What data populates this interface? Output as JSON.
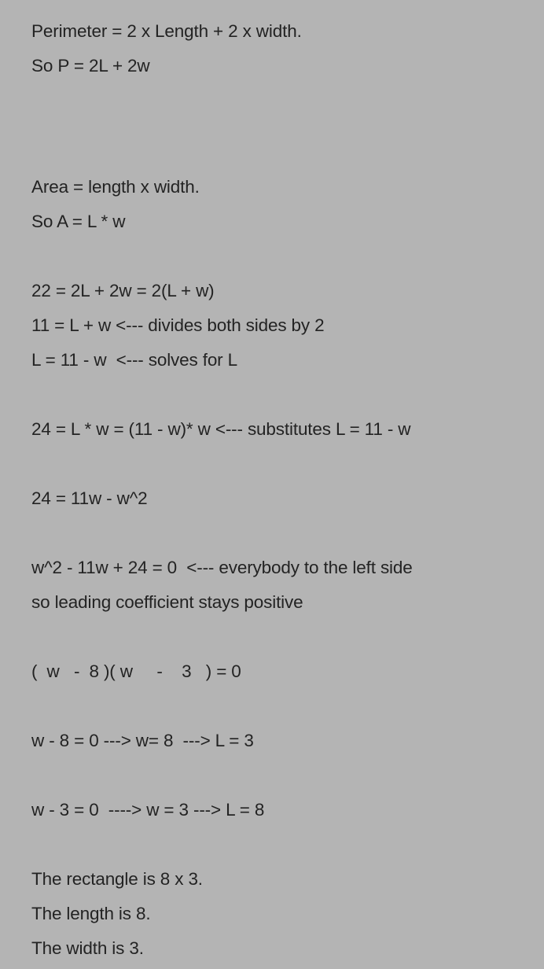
{
  "document": {
    "background_color": "#b4b4b4",
    "text_color": "#232323",
    "title": "Rectangle perimeter and area word problem solution",
    "blocks": [
      {
        "id": "formulas-perimeter",
        "lines": [
          "Perimeter = 2 x Length + 2 x width.",
          "So P = 2L + 2w"
        ]
      },
      {
        "id": "formulas-area",
        "lines": [
          "Area = length x width.",
          "So A = L * w"
        ]
      },
      {
        "id": "solve-for-L",
        "lines": [
          "22 = 2L + 2w = 2(L + w)",
          "11 = L + w <--- divides both sides by 2",
          "L = 11 - w  <--- solves for L"
        ]
      },
      {
        "id": "substitution",
        "lines": [
          "24 = L * w = (11 - w)* w <--- substitutes L = 11 - w"
        ]
      },
      {
        "id": "expanded",
        "lines": [
          "24 = 11w - w^2"
        ]
      },
      {
        "id": "standard-form",
        "lines": [
          "w^2 - 11w + 24 = 0  <--- everybody to the left side",
          "so leading coefficient stays positive"
        ]
      },
      {
        "id": "factored",
        "lines": [
          "(  w   -  8 )( w     -    3   ) = 0"
        ]
      },
      {
        "id": "root-one",
        "lines": [
          "w - 8 = 0 ---> w= 8  ---> L = 3"
        ]
      },
      {
        "id": "root-two",
        "lines": [
          "w - 3 = 0  ----> w = 3 ---> L = 8"
        ]
      },
      {
        "id": "conclusion",
        "lines": [
          "The rectangle is 8 x 3.",
          "The length is 8.",
          "The width is 3."
        ]
      }
    ]
  }
}
